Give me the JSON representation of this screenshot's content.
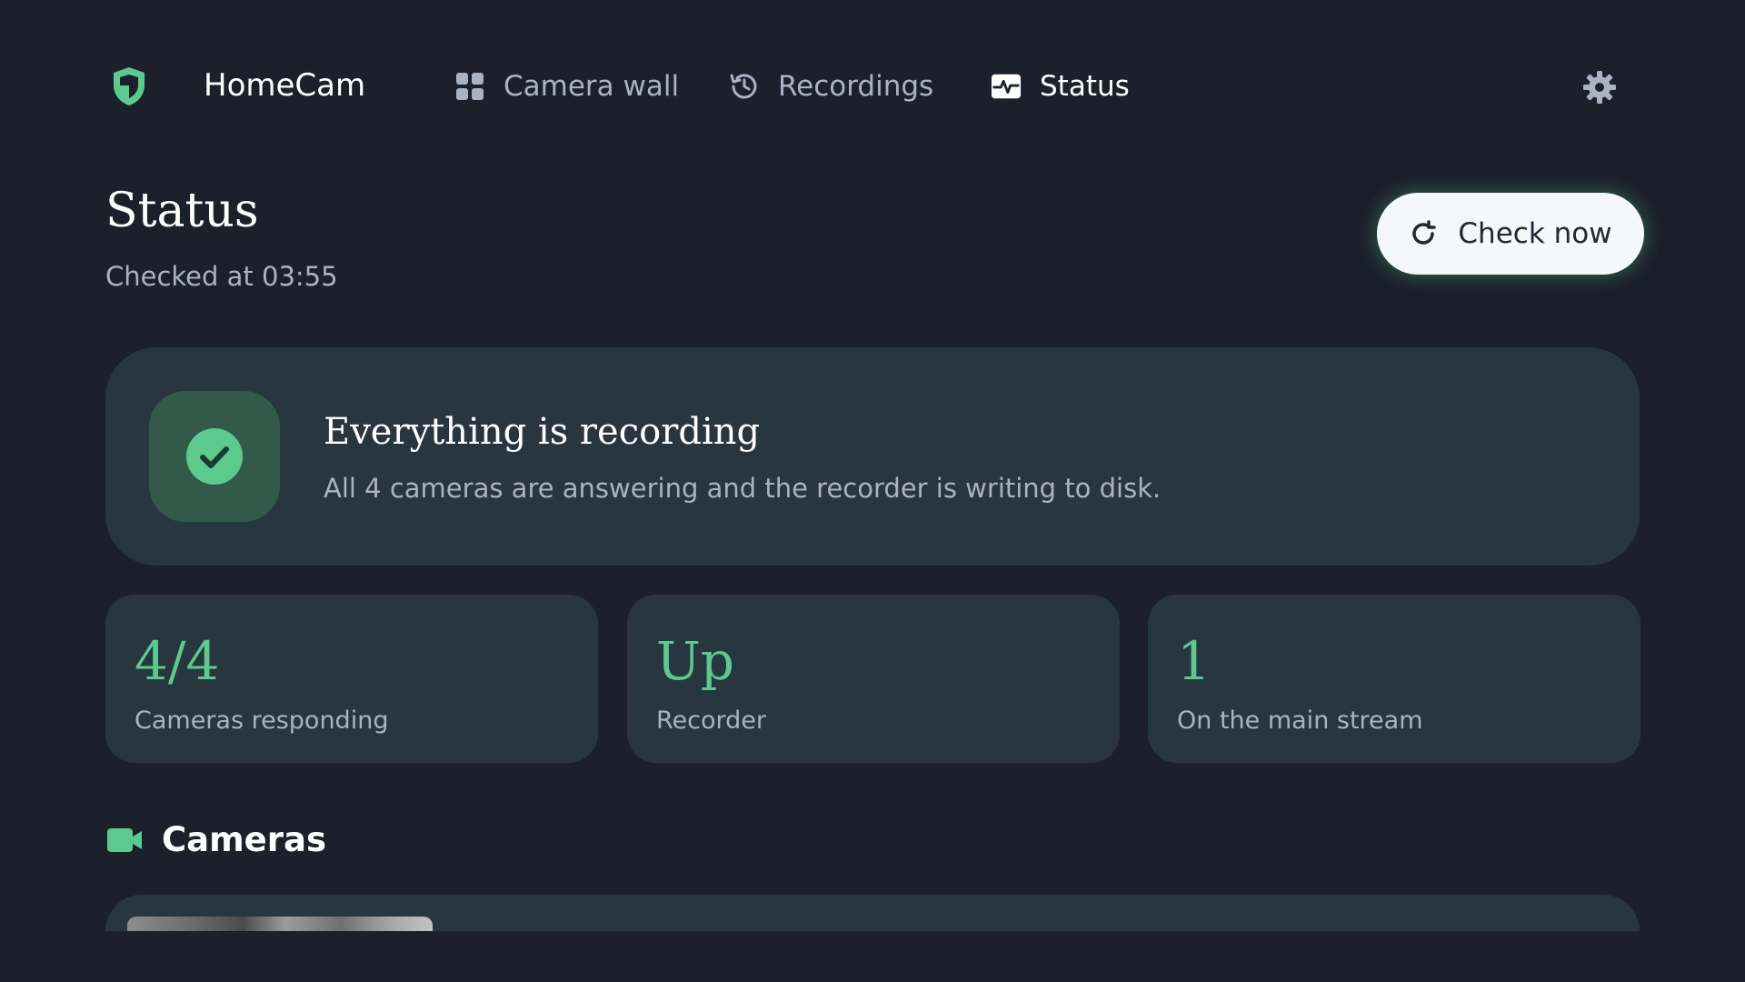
{
  "app": {
    "name": "HomeCam",
    "colors": {
      "background": "#1b202b",
      "card": "#283640",
      "accent": "#5cc98e",
      "muted_text": "#a9b3c4"
    }
  },
  "nav": {
    "items": [
      {
        "label": "Camera wall",
        "icon": "grid-icon",
        "active": false
      },
      {
        "label": "Recordings",
        "icon": "history-icon",
        "active": false
      },
      {
        "label": "Status",
        "icon": "pulse-icon",
        "active": true
      }
    ],
    "settings_icon": "gear-icon"
  },
  "page": {
    "title": "Status",
    "checked_at": "Checked at 03:55",
    "check_button_label": "Check now"
  },
  "summary": {
    "title": "Everything is recording",
    "subtitle": "All 4 cameras are answering and the recorder is writing to disk.",
    "icon": "check-circle-icon"
  },
  "stats": [
    {
      "value": "4/4",
      "label": "Cameras responding"
    },
    {
      "value": "Up",
      "label": "Recorder"
    },
    {
      "value": "1",
      "label": "On the main stream"
    }
  ],
  "cameras_section": {
    "title": "Cameras",
    "icon": "video-camera-icon"
  }
}
